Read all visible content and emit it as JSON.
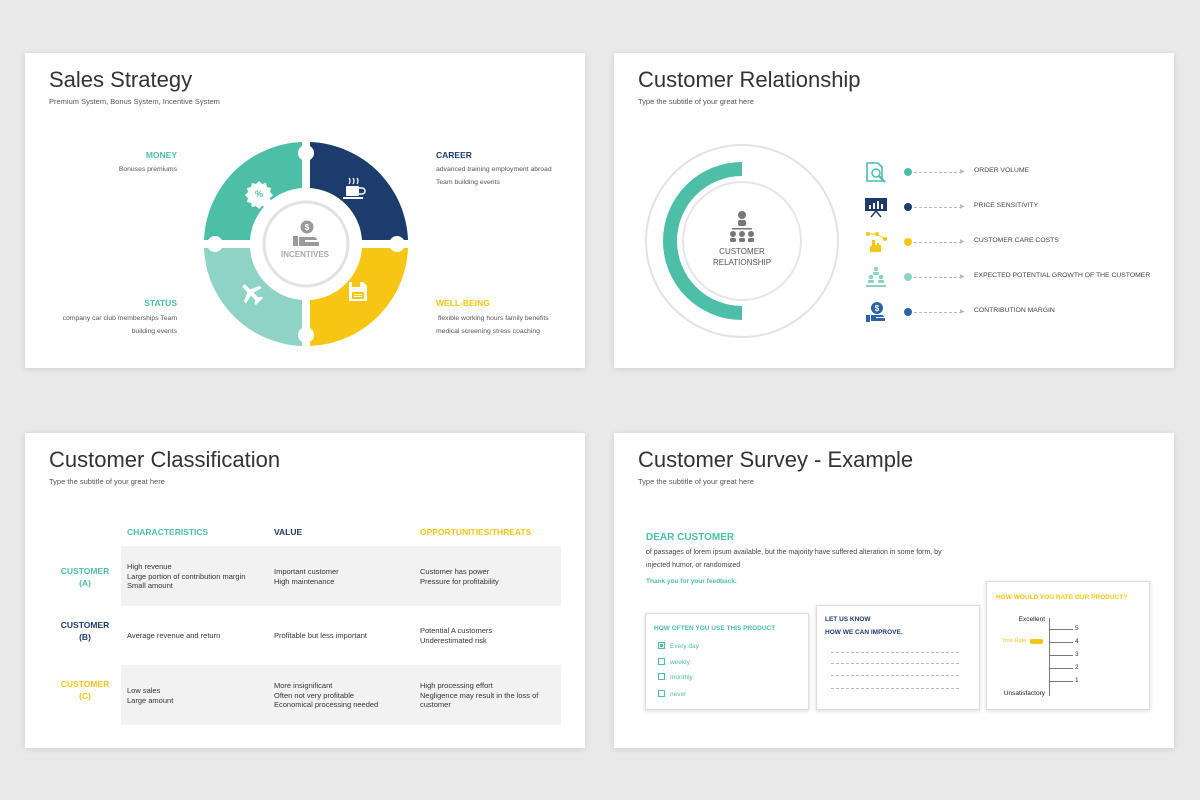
{
  "colors": {
    "teal": "#4dbfa6",
    "navy": "#1d3c6e",
    "yellow": "#f7c614",
    "light_teal": "#8fd3c6",
    "blue": "#2f63a6"
  },
  "s1": {
    "title": "Sales Strategy",
    "subtitle": "Premium System, Bonus System, Incentive System",
    "center_label": "INCENTIVES",
    "money": {
      "head": "MONEY",
      "text": "Bonuses premiums"
    },
    "career": {
      "head": "CAREER",
      "line1": "advanced training employment abroad",
      "line2": "Team building events"
    },
    "status": {
      "head": "STATUS",
      "line1": "company car club memberships Team",
      "line2": "building events"
    },
    "wellbeing": {
      "head": "WELL-BEING",
      "line1": "flexible working hours family benefits",
      "line2": "medical screening stress coaching"
    },
    "icons": [
      "percent-badge-icon",
      "coffee-cup-icon",
      "airplane-icon",
      "floppy-disk-icon",
      "hand-dollar-icon"
    ]
  },
  "s2": {
    "title": "Customer Relationship",
    "subtitle": "Type the subtitle of your great here",
    "center_line1": "CUSTOMER",
    "center_line2": "RELATIONSHIP",
    "metrics": [
      {
        "label": "ORDER VOLUME",
        "icon": "document-search-icon",
        "color": "#4dbfa6"
      },
      {
        "label": "PRICE SENSITIVITY",
        "icon": "presentation-chart-icon",
        "color": "#1d3c6e"
      },
      {
        "label": "CUSTOMER CARE COSTS",
        "icon": "hand-network-icon",
        "color": "#f7c614"
      },
      {
        "label": "EXPECTED POTENTIAL GROWTH OF THE CUSTOMER",
        "icon": "people-pyramid-icon",
        "color": "#8fd3c6"
      },
      {
        "label": "CONTRIBUTION MARGIN",
        "icon": "hand-dollar-icon",
        "color": "#2f63a6"
      }
    ]
  },
  "s3": {
    "title": "Customer Classification",
    "subtitle": "Type the subtitle of your great here",
    "headers": [
      "CHARACTERISTICS",
      "VALUE",
      "OPPORTUNITIES/THREATS"
    ],
    "rows": [
      {
        "label1": "CUSTOMER",
        "label2": "(A)",
        "c1": [
          "High revenue",
          "Large portion of contribution margin",
          "Small amount"
        ],
        "c2": [
          "Important customer",
          "High maintenance"
        ],
        "c3": [
          "Customer has power",
          "Pressure for profitability"
        ]
      },
      {
        "label1": "CUSTOMER",
        "label2": "(B)",
        "c1": [
          "Average revenue and return"
        ],
        "c2": [
          "Profitable but less important"
        ],
        "c3": [
          "Potential A customers",
          "Underestimated risk"
        ]
      },
      {
        "label1": "CUSTOMER",
        "label2": "(C)",
        "c1": [
          "Low sales",
          "Large amount"
        ],
        "c2": [
          "More insignificant",
          "Often not very profitable",
          "Economical processing needed"
        ],
        "c3": [
          "High processing effort",
          "Negligence may result in the loss of",
          "customer"
        ]
      }
    ]
  },
  "s4": {
    "title": "Customer Survey - Example",
    "subtitle": "Type the subtitle of your great here",
    "dear": "DEAR CUSTOMER",
    "body_line1": "of passages of lorem ipsum available, but the majority have suffered alteration in some form, by",
    "body_line2": "injected humor, or randomized",
    "thanks": "Thank you for your feedback.",
    "card1": {
      "title": "HOW OFTEN YOU USE THIS PRODUCT",
      "options": [
        "Every day",
        "weekly",
        "monthly",
        "never"
      ],
      "checked": 0
    },
    "card2": {
      "title1": "LET US KNOW",
      "title2": "HOW WE CAN IMPROVE."
    },
    "card3": {
      "title": "HOW WOULD YOU RATE OUR PRODUCT?",
      "top": "Excellent",
      "bottom": "Unsatisfactory",
      "your_rate": "Your Rate",
      "scale": [
        "5",
        "4",
        "3",
        "2",
        "1"
      ],
      "rating": 4
    }
  }
}
